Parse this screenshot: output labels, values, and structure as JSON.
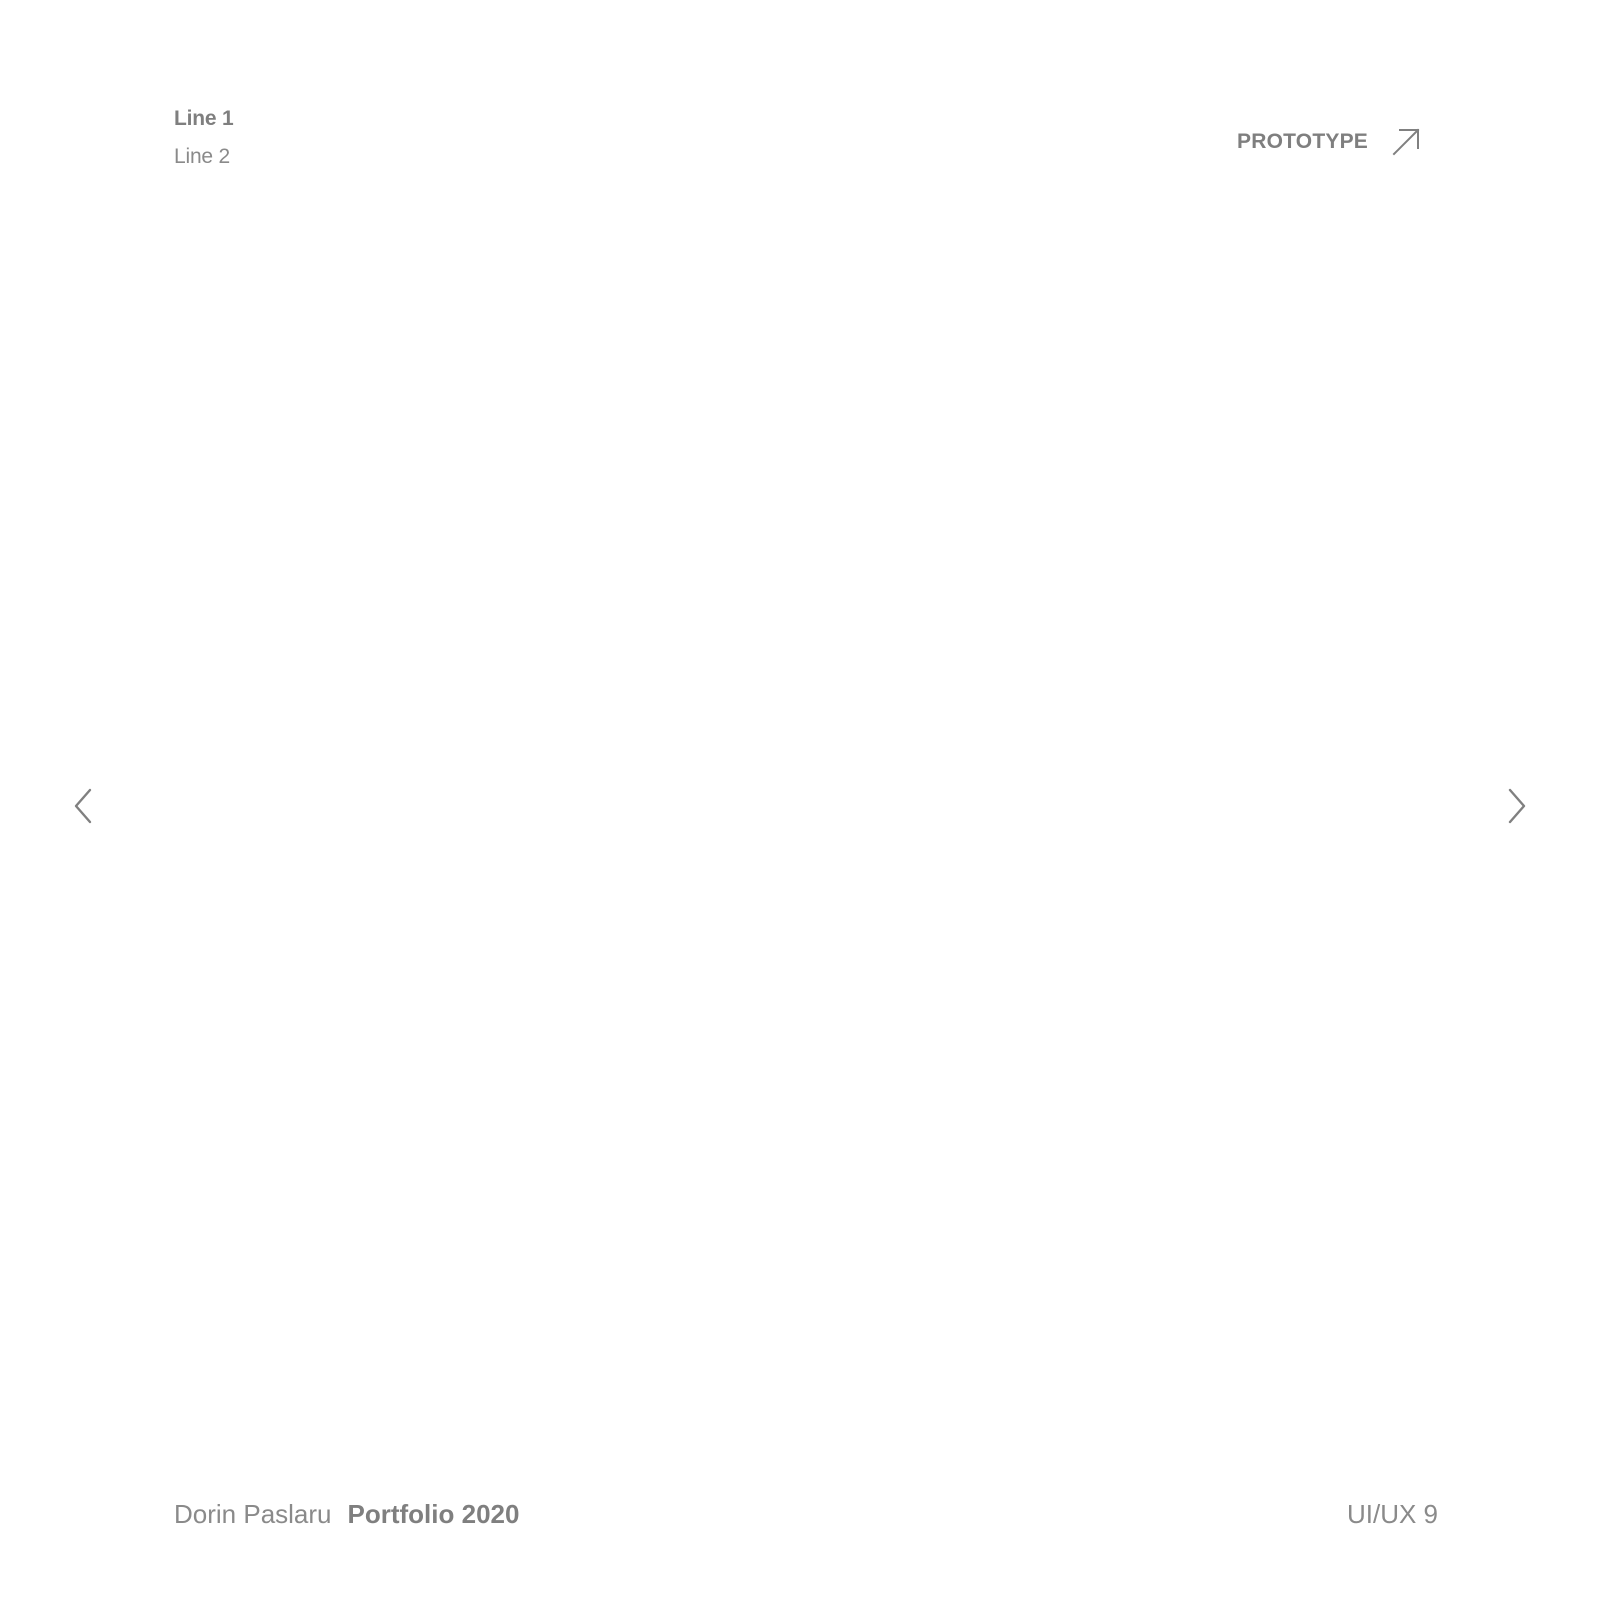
{
  "header": {
    "line1": "Line 1",
    "line2": "Line 2"
  },
  "prototype_link": {
    "label": "PROTOTYPE",
    "icon": "arrow-up-right-icon"
  },
  "navigation": {
    "prev_icon": "chevron-left-icon",
    "next_icon": "chevron-right-icon"
  },
  "footer": {
    "author": "Dorin Paslaru",
    "title": "Portfolio 2020",
    "page_label": "UI/UX 9"
  },
  "colors": {
    "text_gray": "#808080",
    "background": "#ffffff"
  }
}
